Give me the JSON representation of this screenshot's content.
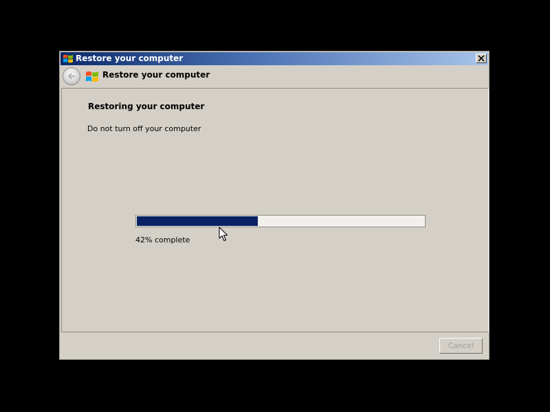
{
  "window": {
    "title": "Restore your computer",
    "title_bar_color": "#0b2a6a",
    "logo_icon": "windows-logo-icon",
    "close_icon": "close-icon"
  },
  "header": {
    "back_icon": "back-arrow-icon",
    "title": "Restore your computer"
  },
  "main": {
    "heading": "Restoring your computer",
    "message": "Do not turn off your computer",
    "progress": {
      "percent": 42,
      "label": "42% complete",
      "fill_color": "#0a2163"
    }
  },
  "footer": {
    "cancel_label": "Cancel",
    "cancel_enabled": false
  }
}
